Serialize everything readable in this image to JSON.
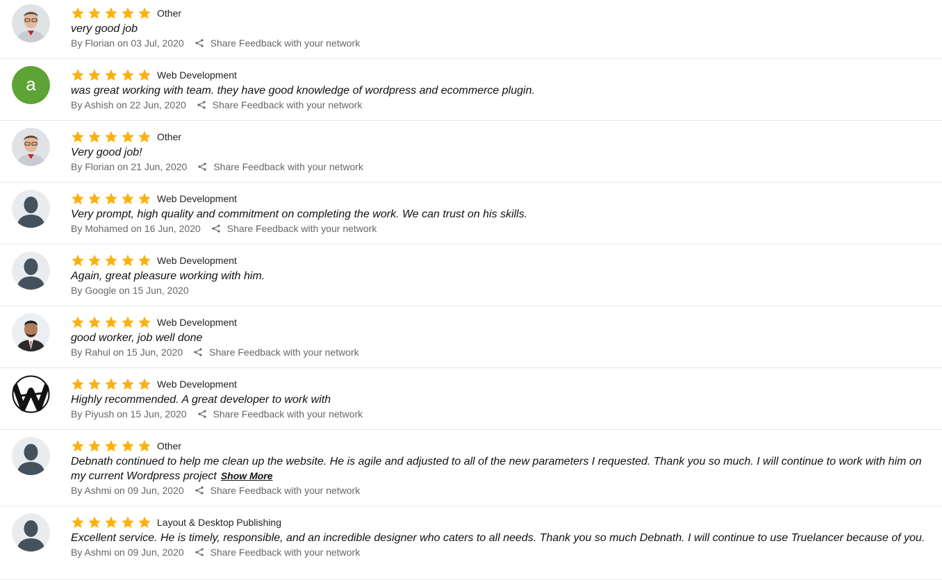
{
  "share_label": "Share Feedback with your network",
  "star_color": "#fbb110",
  "reviews": [
    {
      "avatar": "photo-man-glasses",
      "rating": 5,
      "category": "Other",
      "comment": "very good job",
      "byline": "By Florian on 03 Jul, 2020",
      "has_share": true,
      "show_more": ""
    },
    {
      "avatar": "letter-a",
      "avatar_letter": "a",
      "avatar_color": "#5ea335",
      "rating": 5,
      "category": "Web Development",
      "comment": "was great working with team. they have good knowledge of wordpress and ecommerce plugin.",
      "byline": "By Ashish on 22 Jun, 2020",
      "has_share": true,
      "show_more": ""
    },
    {
      "avatar": "photo-man-glasses",
      "rating": 5,
      "category": "Other",
      "comment": "Very good job!",
      "byline": "By Florian on 21 Jun, 2020",
      "has_share": true,
      "show_more": ""
    },
    {
      "avatar": "default-silhouette",
      "rating": 5,
      "category": "Web Development",
      "comment": "Very prompt, high quality and commitment on completing the work. We can trust on his skills.",
      "byline": "By Mohamed on 16 Jun, 2020",
      "has_share": true,
      "show_more": ""
    },
    {
      "avatar": "default-silhouette",
      "rating": 5,
      "category": "Web Development",
      "comment": "Again, great pleasure working with him.",
      "byline": "By Google on 15 Jun, 2020",
      "has_share": false,
      "show_more": ""
    },
    {
      "avatar": "photo-man-suit",
      "rating": 5,
      "category": "Web Development",
      "comment": "good worker, job well done",
      "byline": "By Rahul on 15 Jun, 2020",
      "has_share": true,
      "show_more": ""
    },
    {
      "avatar": "logo-w",
      "rating": 5,
      "category": "Web Development",
      "comment": "Highly recommended. A great developer to work with",
      "byline": "By Piyush on 15 Jun, 2020",
      "has_share": true,
      "show_more": ""
    },
    {
      "avatar": "default-silhouette",
      "rating": 5,
      "category": "Other",
      "comment": "Debnath continued to help me clean up the website. He is agile and adjusted to all of the new parameters I requested. Thank you so much. I will continue to work with him on my current Wordpress project",
      "byline": "By Ashmi on 09 Jun, 2020",
      "has_share": true,
      "show_more": "Show More"
    },
    {
      "avatar": "default-silhouette",
      "rating": 5,
      "category": "Layout & Desktop Publishing",
      "comment": "Excellent service. He is timely, responsible, and an incredible designer who caters to all needs. Thank you so much Debnath. I will continue to use Truelancer because of you.",
      "byline": "By Ashmi on 09 Jun, 2020",
      "has_share": true,
      "show_more": ""
    }
  ]
}
